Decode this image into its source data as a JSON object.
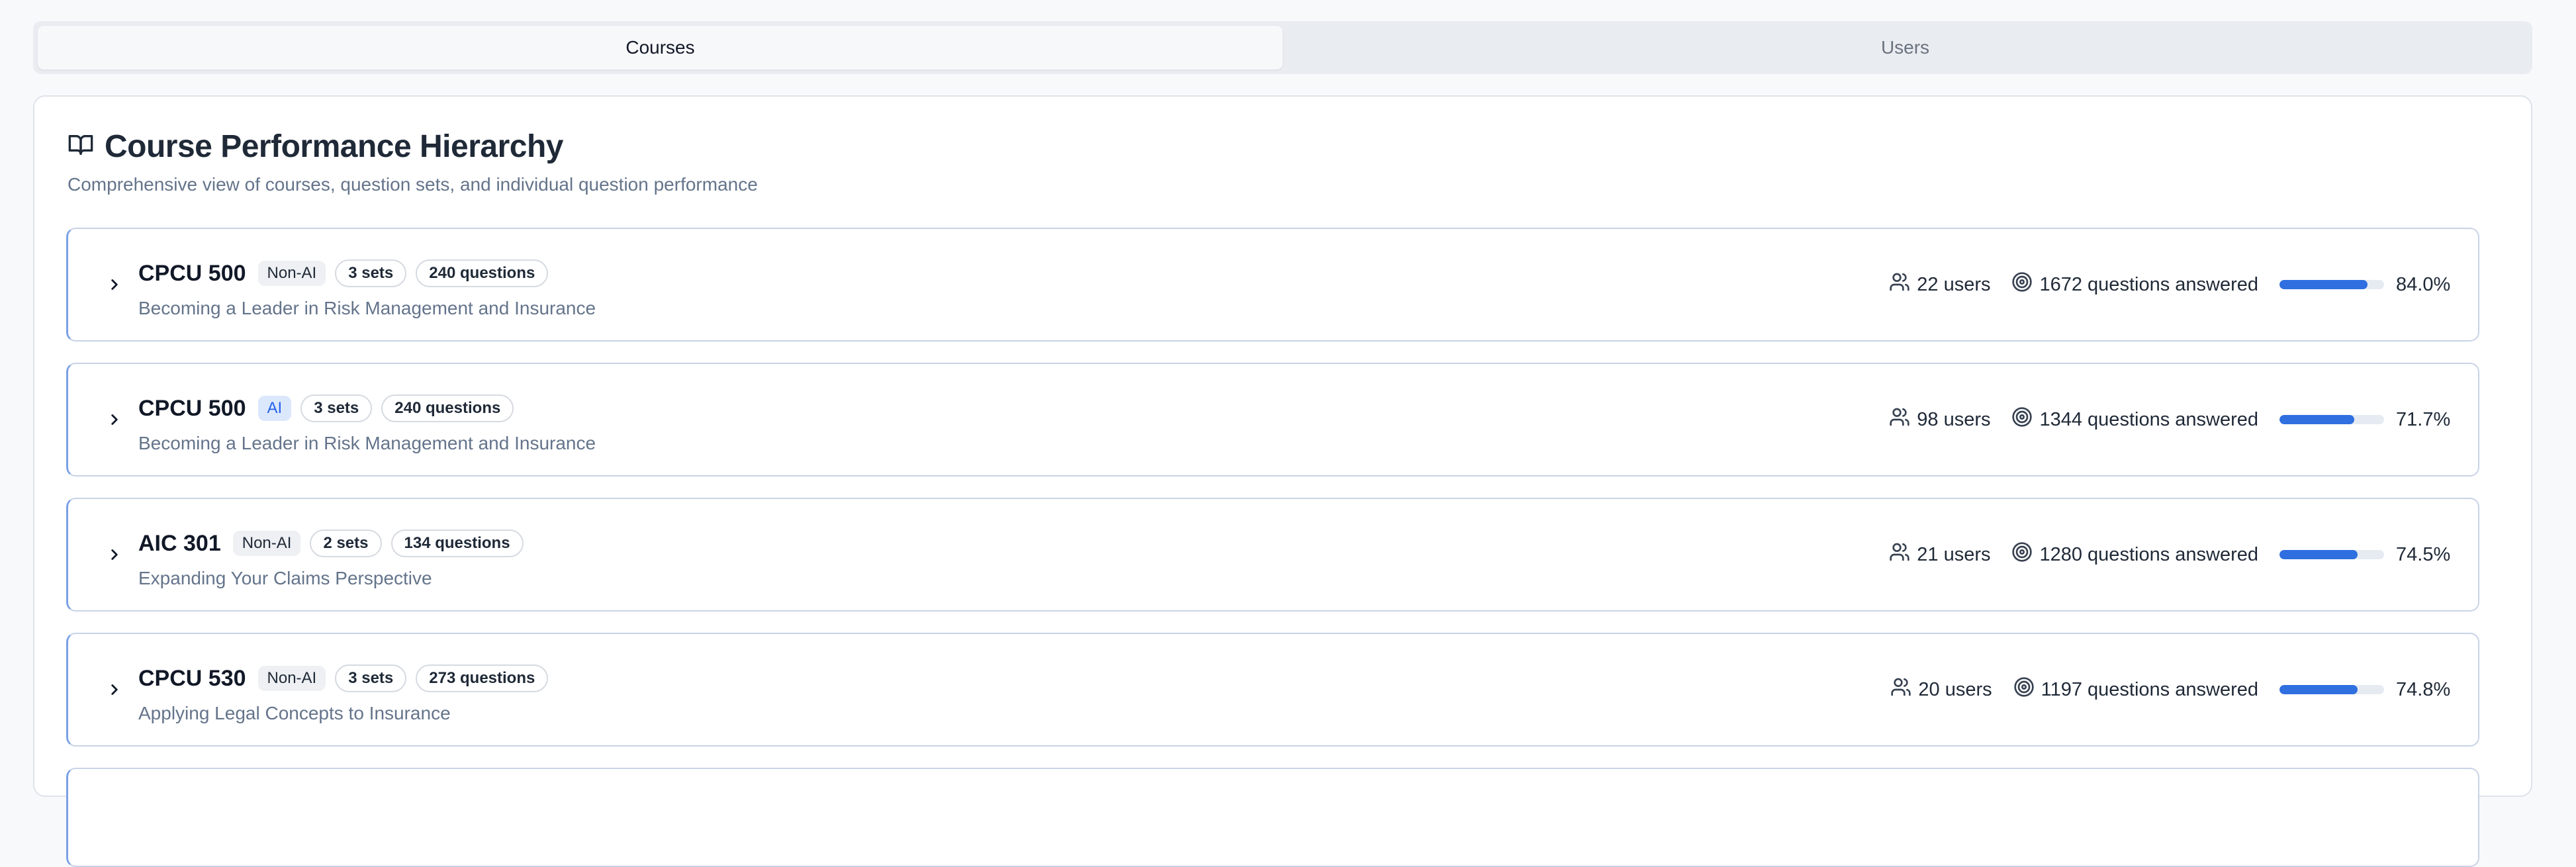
{
  "tabs": [
    {
      "label": "Courses",
      "active": true
    },
    {
      "label": "Users",
      "active": false
    }
  ],
  "header": {
    "icon": "book-open-icon",
    "title": "Course Performance Hierarchy",
    "subtitle": "Comprehensive view of courses, question sets, and individual question performance"
  },
  "courses": [
    {
      "code": "CPCU 500",
      "type": "Non-AI",
      "sets": "3 sets",
      "questions": "240 questions",
      "title": "Becoming a Leader in Risk Management and Insurance",
      "users": "22 users",
      "answered": "1672 questions answered",
      "score": 84.0,
      "score_label": "84.0%"
    },
    {
      "code": "CPCU 500",
      "type": "AI",
      "sets": "3 sets",
      "questions": "240 questions",
      "title": "Becoming a Leader in Risk Management and Insurance",
      "users": "98 users",
      "answered": "1344 questions answered",
      "score": 71.7,
      "score_label": "71.7%"
    },
    {
      "code": "AIC 301",
      "type": "Non-AI",
      "sets": "2 sets",
      "questions": "134 questions",
      "title": "Expanding Your Claims Perspective",
      "users": "21 users",
      "answered": "1280 questions answered",
      "score": 74.5,
      "score_label": "74.5%"
    },
    {
      "code": "CPCU 530",
      "type": "Non-AI",
      "sets": "3 sets",
      "questions": "273 questions",
      "title": "Applying Legal Concepts to Insurance",
      "users": "20 users",
      "answered": "1197 questions answered",
      "score": 74.8,
      "score_label": "74.8%"
    }
  ],
  "colors": {
    "accent": "#2f6fe0",
    "ai_badge_bg": "#dbe7fb",
    "ai_badge_text": "#2563eb"
  }
}
